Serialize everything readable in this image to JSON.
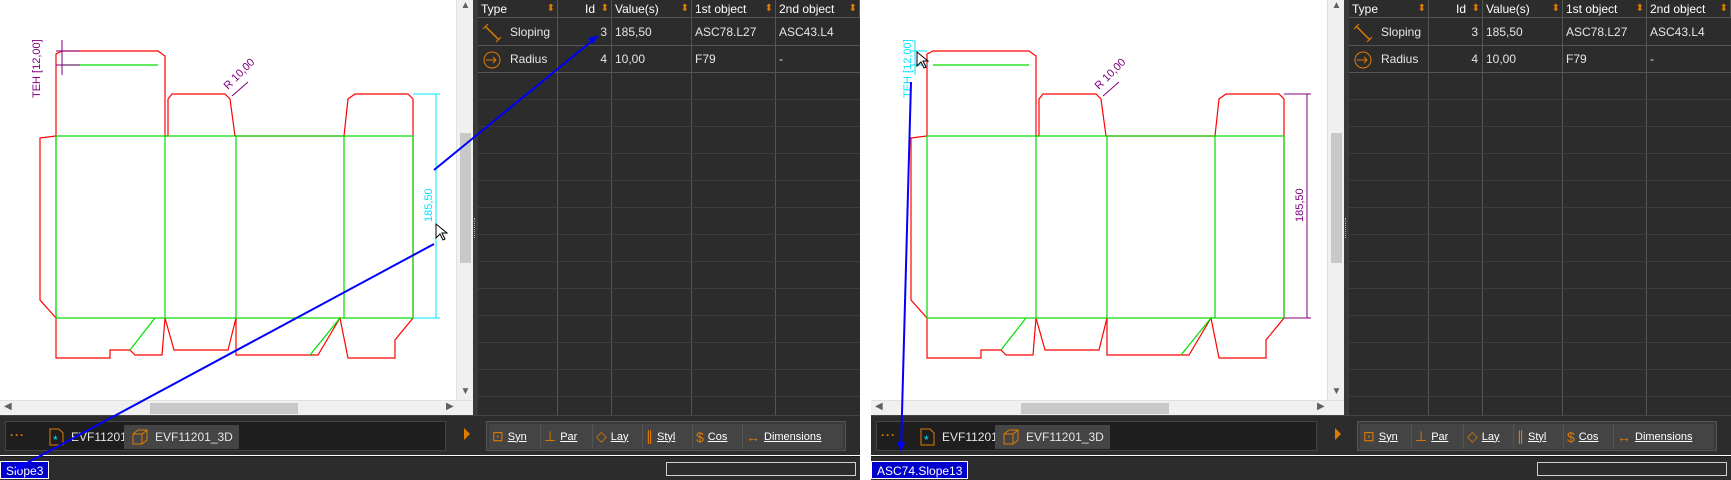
{
  "colors": {
    "accent": "#e07b00",
    "cutline": "#ff0000",
    "creaseline": "#00dd00",
    "dim_selected": "#00e5ff",
    "dim_normal": "#800080",
    "pointer_line": "#0000ff",
    "status_bg": "#0000cc"
  },
  "left": {
    "canvas": {
      "dim_teh": "TEH [12,00]",
      "dim_radius": "R 10,00",
      "dim_height": "185,50"
    },
    "tabs": {
      "active": "EVF11201",
      "inactive": "EVF11201_3D"
    },
    "status": "Slope3"
  },
  "right": {
    "canvas": {
      "dim_teh": "TEH [12,00]",
      "dim_radius": "R 10,00",
      "dim_height": "185,50"
    },
    "tabs": {
      "active": "EVF11201",
      "inactive": "EVF11201_3D"
    },
    "status": "ASC74.Slope13"
  },
  "table": {
    "columns": [
      "Type",
      "Id",
      "Value(s)",
      "1st object",
      "2nd object"
    ],
    "rows": [
      {
        "type": "Sloping",
        "id": "3",
        "value": "185,50",
        "first": "ASC78.L27",
        "second": "ASC43.L4",
        "icon": "sloping-dimension-icon"
      },
      {
        "type": "Radius",
        "id": "4",
        "value": "10,00",
        "first": "F79",
        "second": "-",
        "icon": "radius-dimension-icon"
      }
    ]
  },
  "toolbar": {
    "buttons": [
      {
        "label": "Syn",
        "icon": "symbol-icon"
      },
      {
        "label": "Par",
        "icon": "parallel-icon"
      },
      {
        "label": "Lay",
        "icon": "layer-icon"
      },
      {
        "label": "Styl",
        "icon": "style-icon"
      },
      {
        "label": "Cos",
        "icon": "cost-icon"
      },
      {
        "label": "Dimensions",
        "icon": "dimensions-icon"
      }
    ]
  }
}
